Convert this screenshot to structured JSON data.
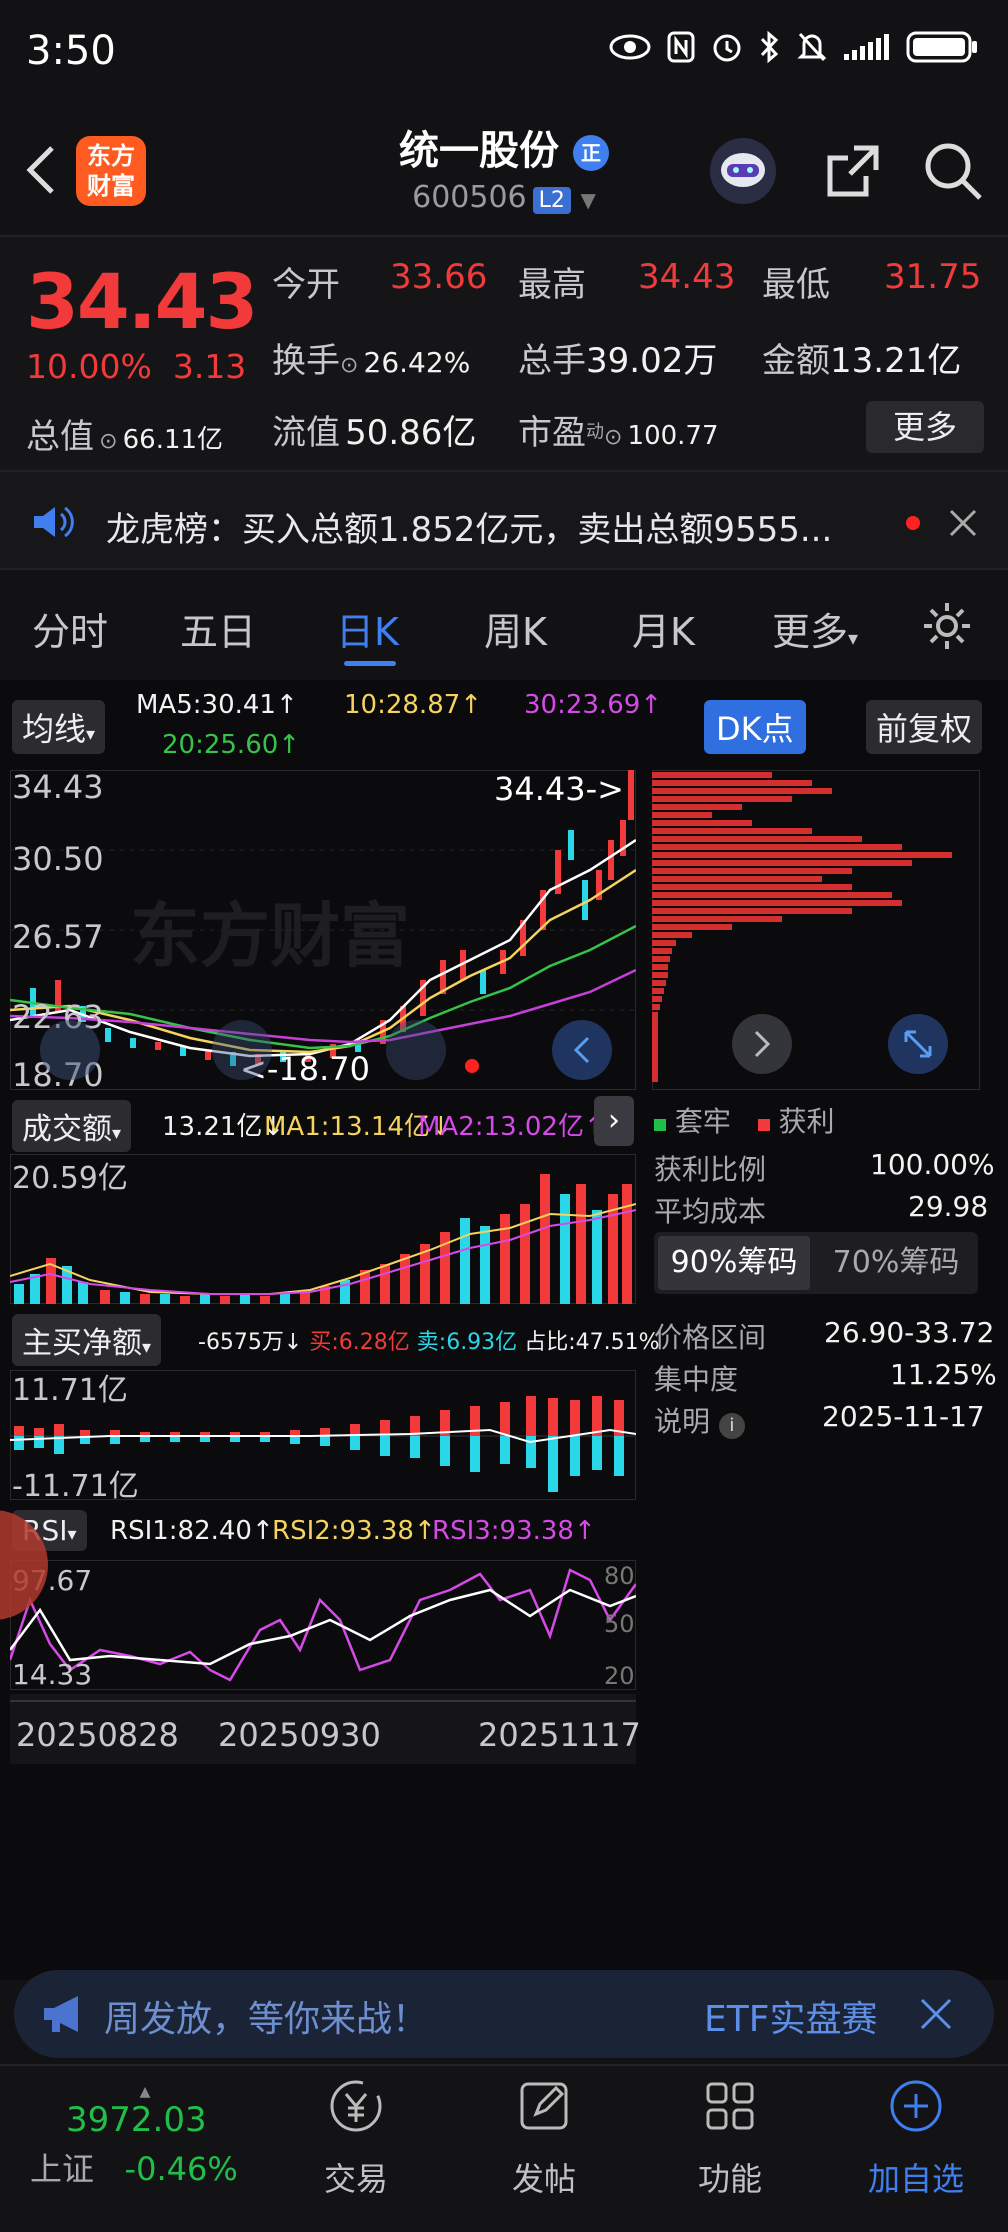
{
  "status": {
    "time": "3:50"
  },
  "header": {
    "logo_text_1": "东方",
    "logo_text_2": "财富",
    "stock_name": "统一股份",
    "stock_tag": "正",
    "stock_code": "600506",
    "level": "L2"
  },
  "quote": {
    "price": "34.43",
    "change_pct": "10.00%",
    "change_amt": "3.13",
    "open_label": "今开",
    "open": "33.66",
    "high_label": "最高",
    "high": "34.43",
    "low_label": "最低",
    "low": "31.75",
    "turnover_label": "换手",
    "turnover": "26.42%",
    "volume_label": "总手",
    "volume": "39.02万",
    "amount_label": "金额",
    "amount": "13.21亿",
    "mktcap_label": "总值",
    "mktcap": "66.11亿",
    "float_label": "流值",
    "float": "50.86亿",
    "pe_label": "市盈",
    "pe_sup": "动",
    "pe": "100.77",
    "more": "更多"
  },
  "notice": {
    "text": "龙虎榜：买入总额1.852亿元，卖出总额9555..."
  },
  "tabs": [
    "分时",
    "五日",
    "日K",
    "周K",
    "月K",
    "更多"
  ],
  "active_tab": 2,
  "kline": {
    "indicator": "均线",
    "ma5": "MA5:30.41↑",
    "ma10": "10:28.87↑",
    "ma30": "30:23.69↑",
    "ma20": "20:25.60↑",
    "dk_button": "DK点",
    "adjust_button": "前复权",
    "y_labels": [
      "34.43",
      "30.50",
      "26.57",
      "22.63",
      "18.70"
    ],
    "last_price_marker": "34.43->",
    "low_marker": "<-18.70",
    "watermark": "东方财富"
  },
  "chip": {
    "legend_trapped": "套牢",
    "legend_profit": "获利",
    "rows": [
      {
        "label": "获利比例",
        "value": "100.00%"
      },
      {
        "label": "平均成本",
        "value": "29.98"
      }
    ],
    "tab_90": "90%筹码",
    "tab_70": "70%筹码",
    "rows2": [
      {
        "label": "价格区间",
        "value": "26.90-33.72"
      },
      {
        "label": "集中度",
        "value": "11.25%"
      },
      {
        "label": "说明",
        "value": "2025-11-17"
      }
    ]
  },
  "volume": {
    "indicator": "成交额",
    "val": "13.21亿↓",
    "ma1": "MA1:13.14亿↓",
    "ma2": "MA2:13.02亿↑",
    "top_label": "20.59亿"
  },
  "netbuy": {
    "indicator": "主买净额",
    "val": "-6575万↓",
    "buy": "买:6.28亿",
    "sell": "卖:6.93亿",
    "ratio": "占比:47.51%",
    "top_label": "11.71亿",
    "bottom_label": "-11.71亿"
  },
  "rsi": {
    "indicator": "RSI",
    "rsi1": "RSI1:82.40↑",
    "rsi2": "RSI2:93.38↑",
    "rsi3": "RSI3:93.38↑",
    "top_label": "97.67",
    "bottom_label": "14.33",
    "r80": "80",
    "r50": "50",
    "r20": "20"
  },
  "dates": [
    "20250828",
    "20250930",
    "20251117"
  ],
  "banner": {
    "text": "周发放，等你来战！",
    "etf": "ETF实盘赛"
  },
  "tabbar": {
    "index_value": "3972.03",
    "index_name": "上证",
    "index_change": "-0.46%",
    "items": [
      "交易",
      "发帖",
      "功能",
      "加自选"
    ]
  },
  "colors": {
    "up": "#f23a3a",
    "down": "#2ad7e8",
    "accent": "#3f7ff0",
    "ma5": "#ffffff",
    "ma10": "#f4d35e",
    "ma20": "#37c24a",
    "ma30": "#c640d8"
  }
}
